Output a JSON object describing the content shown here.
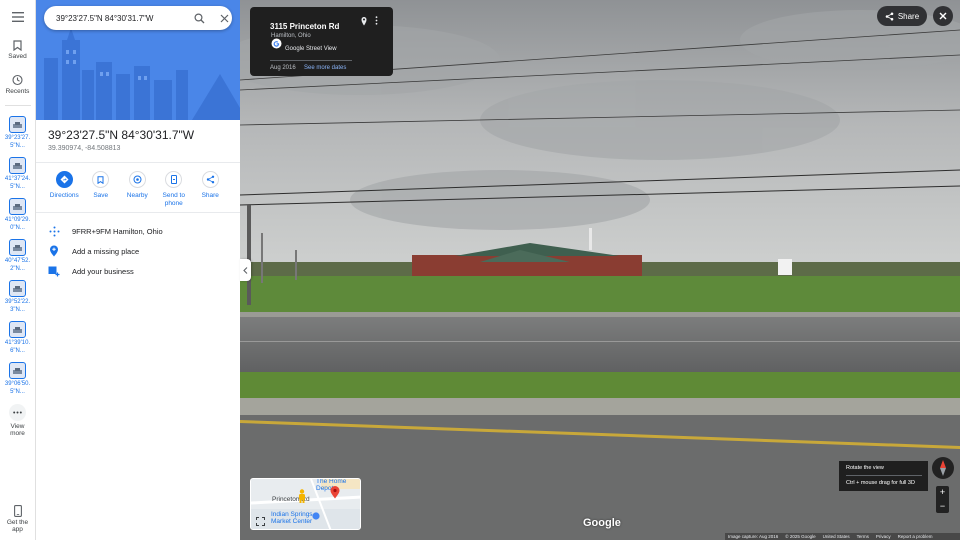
{
  "search": {
    "value": "39°23'27.5\"N 84°30'31.7\"W"
  },
  "rail": {
    "saved_label": "Saved",
    "recents_label": "Recents",
    "history": [
      "39°23'27.5\"N...",
      "41°37'24.5\"N...",
      "41°09'29.0\"N...",
      "40°47'52.2\"N...",
      "39°52'22.3\"N...",
      "41°39'10.6\"N...",
      "39°06'50.5\"N..."
    ],
    "view_more_label": "View more",
    "get_app_label": "Get the app"
  },
  "place": {
    "title": "39°23'27.5\"N 84°30'31.7\"W",
    "coords": "39.390974, -84.508813"
  },
  "actions": {
    "directions": "Directions",
    "save": "Save",
    "nearby": "Nearby",
    "send_to_phone": "Send to phone",
    "share": "Share"
  },
  "info": {
    "plus_code": "9FRR+9FM Hamilton, Ohio",
    "add_missing_place": "Add a missing place",
    "add_business": "Add your business"
  },
  "streetview_card": {
    "address": "3115 Princeton Rd",
    "city": "Hamilton, Ohio",
    "source": "Google Street View",
    "date": "Aug 2016",
    "see_more_dates": "See more dates"
  },
  "top_controls": {
    "share_label": "Share"
  },
  "rotate_tip": {
    "line1": "Rotate the view",
    "line2": "Ctrl + mouse drag for full 3D"
  },
  "minimap": {
    "label_princeton": "Princeton Rd",
    "label_home_depot": "The Home Depot",
    "label_indian_springs": "Indian Springs Market Center"
  },
  "zoom": {
    "plus": "+",
    "minus": "−"
  },
  "google_logo": "Google",
  "footer": {
    "capture": "Image capture: Aug 2016",
    "copyright": "© 2025 Google",
    "us": "United States",
    "terms": "Terms",
    "privacy": "Privacy",
    "report": "Report a problem"
  },
  "colors": {
    "accent": "#1a73e8",
    "hero": "#4a86e8",
    "card_bg": "#1f1f1f",
    "pin_red": "#ea4335"
  }
}
